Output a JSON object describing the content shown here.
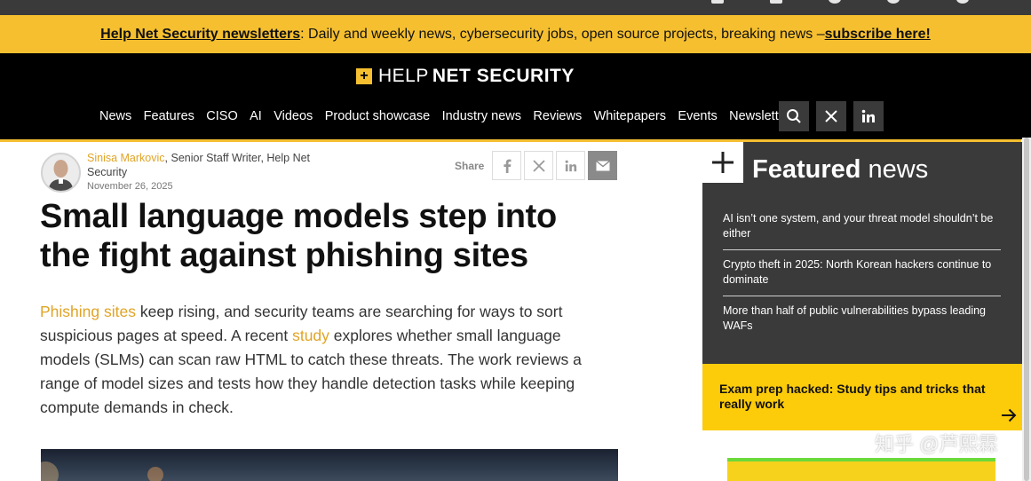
{
  "topbar": {
    "icons": [
      "rss-icon",
      "facebook-icon",
      "search-icon",
      "settings-icon",
      "user-icon"
    ]
  },
  "banner": {
    "link_text": "Help Net Security newsletters",
    "text": ": Daily and weekly news, cybersecurity jobs, open source projects, breaking news – ",
    "cta": "subscribe here!"
  },
  "header": {
    "logo_mark": "+",
    "logo_help": "HELP",
    "logo_rest": "NET SECURITY",
    "nav": [
      "News",
      "Features",
      "CISO",
      "AI",
      "Videos",
      "Product showcase",
      "Industry news",
      "Reviews",
      "Whitepapers",
      "Events",
      "Newsletters"
    ],
    "buttons": [
      "search-icon",
      "x-icon",
      "linkedin-icon"
    ]
  },
  "article": {
    "author_name": "Sinisa Markovic",
    "author_role": ", Senior Staff Writer, Help Net Security",
    "date": "November 26, 2025",
    "share_label": "Share",
    "share_icons": [
      "facebook-icon",
      "x-icon",
      "linkedin-icon",
      "mail-icon"
    ],
    "title": "Small language models step into the fight against phishing sites",
    "lead": {
      "link1": "Phishing sites",
      "text1": " keep rising, and security teams are searching for ways to sort suspicious pages at speed. A recent ",
      "link2": "study",
      "text2": " explores whether small language models (SLMs) can scan raw HTML to catch these threats. The work reviews a range of model sizes and tests how they handle detection tasks while keeping compute demands in check."
    }
  },
  "featured": {
    "title_bold": "Featured",
    "title_rest": " news",
    "items": [
      "AI isn’t one system, and your threat model shouldn’t be either",
      "Crypto theft in 2025: North Korean hackers continue to dominate",
      "More than half of public vulnerabilities bypass leading WAFs"
    ]
  },
  "promo": {
    "text": "Exam prep hacked: Study tips and tricks that really work"
  },
  "watermark": "知乎 @芦熙霖",
  "colors": {
    "accent": "#f5bf30",
    "link": "#e0a426",
    "promo": "#fccb0a",
    "dark_panel": "#3a3a3a"
  }
}
